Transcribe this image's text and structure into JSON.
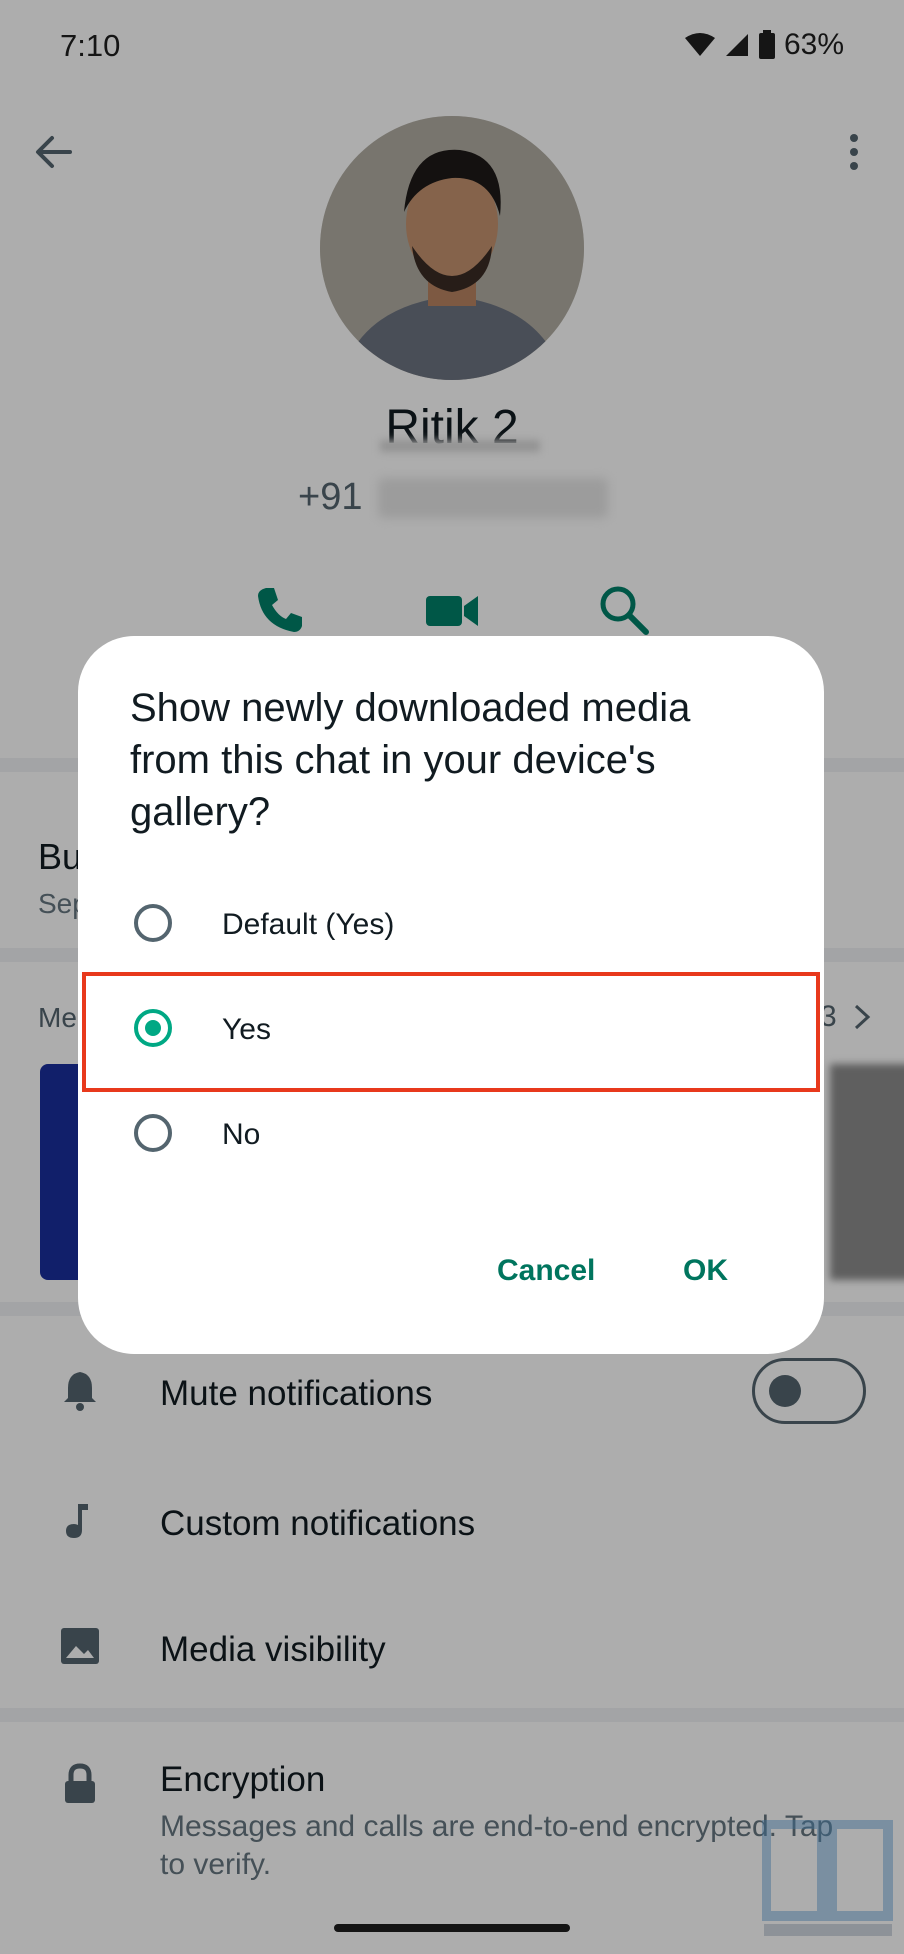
{
  "status_bar": {
    "time": "7:10",
    "battery": "63%"
  },
  "contact": {
    "name": "Ritik 2",
    "phone_prefix": "+91"
  },
  "background": {
    "business_title": "Bu",
    "business_sub": "Sep",
    "media_label": "Me",
    "media_count": "3",
    "rows": [
      {
        "label": "Mute notifications",
        "icon": "bell-icon"
      },
      {
        "label": "Custom notifications",
        "icon": "music-note-icon"
      },
      {
        "label": "Media visibility",
        "icon": "image-icon"
      },
      {
        "label": "Encryption",
        "icon": "lock-icon"
      }
    ],
    "mute_toggle_on": false,
    "encryption_desc": "Messages and calls are end-to-end encrypted. Tap to verify."
  },
  "dialog": {
    "title": "Show newly downloaded media from this chat in your device's gallery?",
    "options": [
      {
        "label": "Default (Yes)",
        "selected": false
      },
      {
        "label": "Yes",
        "selected": true
      },
      {
        "label": "No",
        "selected": false
      }
    ],
    "cancel_label": "Cancel",
    "ok_label": "OK"
  },
  "colors": {
    "accent": "#00a884",
    "highlight_box": "#e8391c"
  }
}
